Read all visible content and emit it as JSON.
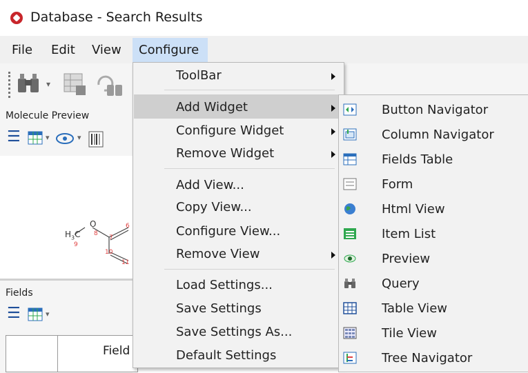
{
  "window": {
    "title": "Database - Search Results"
  },
  "menubar": {
    "file": "File",
    "edit": "Edit",
    "view": "View",
    "configure": "Configure"
  },
  "panes": {
    "molecule_preview": "Molecule Preview",
    "fields": "Fields",
    "fields_column_header": "Field"
  },
  "molecule": {
    "atom_h3c": "H",
    "atom_h3c_sub": "3",
    "atom_c": "C",
    "atom_o": "O",
    "idx_9": "9",
    "idx_8": "8",
    "idx_7": "7",
    "idx_6": "6",
    "idx_10": "10",
    "idx_11": "11"
  },
  "configure_menu": {
    "items": [
      {
        "label": "ToolBar",
        "has_submenu": true
      },
      {
        "label": "Add Widget",
        "has_submenu": true,
        "highlighted": true
      },
      {
        "label": "Configure Widget",
        "has_submenu": true
      },
      {
        "label": "Remove Widget",
        "has_submenu": true
      },
      {
        "label": "Add View..."
      },
      {
        "label": "Copy View..."
      },
      {
        "label": "Configure View..."
      },
      {
        "label": "Remove View",
        "has_submenu": true
      },
      {
        "label": "Load Settings..."
      },
      {
        "label": "Save Settings"
      },
      {
        "label": "Save Settings As..."
      },
      {
        "label": "Default Settings"
      }
    ]
  },
  "add_widget_submenu": {
    "items": [
      {
        "label": "Button Navigator",
        "icon": "button-navigator-icon"
      },
      {
        "label": "Column Navigator",
        "icon": "column-navigator-icon"
      },
      {
        "label": "Fields Table",
        "icon": "fields-table-icon"
      },
      {
        "label": "Form",
        "icon": "form-icon"
      },
      {
        "label": "Html View",
        "icon": "globe-icon"
      },
      {
        "label": "Item List",
        "icon": "item-list-icon"
      },
      {
        "label": "Preview",
        "icon": "eye-icon"
      },
      {
        "label": "Query",
        "icon": "binoculars-icon"
      },
      {
        "label": "Table View",
        "icon": "table-view-icon"
      },
      {
        "label": "Tile View",
        "icon": "tile-view-icon"
      },
      {
        "label": "Tree Navigator",
        "icon": "tree-navigator-icon"
      }
    ]
  },
  "colors": {
    "menu_highlight": "#cfcfcf",
    "menubar_selected": "#cce0f7",
    "app_icon": "#c8262b",
    "icon_blue": "#2a6ebb",
    "icon_green": "#2fa84f"
  }
}
